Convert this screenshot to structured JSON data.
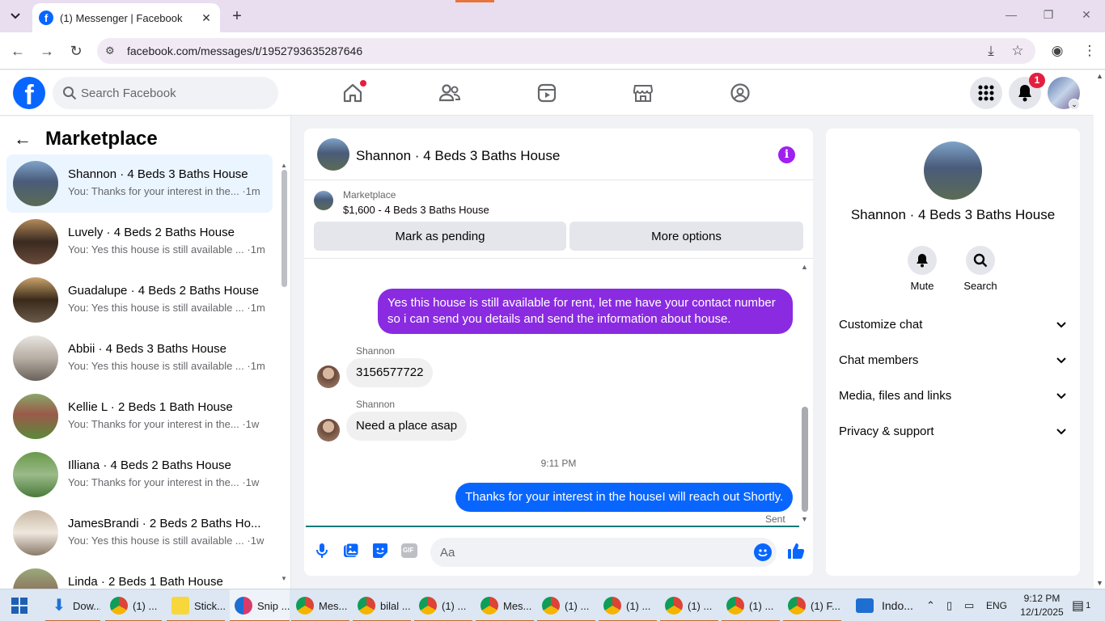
{
  "browser": {
    "tab_title": "(1) Messenger | Facebook",
    "url": "facebook.com/messages/t/1952793635287646"
  },
  "fb": {
    "search_placeholder": "Search Facebook",
    "notification_count": "1"
  },
  "left": {
    "title": "Marketplace",
    "conversations": [
      {
        "name": "Shannon · 4 Beds 3 Baths House",
        "snippet": "You: Thanks for your interest in the... ·1m"
      },
      {
        "name": "Luvely · 4 Beds 2 Baths House",
        "snippet": "You: Yes this house is still available ... ·1m"
      },
      {
        "name": "Guadalupe · 4 Beds 2 Baths House",
        "snippet": "You: Yes this house is still available ... ·1m"
      },
      {
        "name": "Abbii · 4 Beds 3 Baths House",
        "snippet": "You: Yes this house is still available ... ·1m"
      },
      {
        "name": "Kellie L · 2 Beds 1 Bath House",
        "snippet": "You: Thanks for your interest in the... ·1w"
      },
      {
        "name": "Illiana · 4 Beds 2 Baths House",
        "snippet": "You: Thanks for your interest in the... ·1w"
      },
      {
        "name": "JamesBrandi · 2 Beds 2 Baths Ho...",
        "snippet": "You: Yes this house is still available ... ·1w"
      },
      {
        "name": "Linda · 2 Beds 1 Bath House",
        "snippet": ""
      }
    ]
  },
  "chat": {
    "title": "Shannon · 4 Beds 3 Baths House",
    "marketplace_label": "Marketplace",
    "listing": "$1,600 - 4 Beds 3 Baths House",
    "mark_pending": "Mark as pending",
    "more_options": "More options",
    "msg_out_1": "Yes this house is still available for rent, let me have your contact number so i can send you details and send the information about house.",
    "sender_1": "Shannon",
    "msg_in_1": "3156577722",
    "sender_2": "Shannon",
    "msg_in_2": "Need a place asap",
    "timestamp": "9:11 PM",
    "msg_out_2": "Thanks for your interest in the houseI will reach out Shortly.",
    "sent_status": "Sent",
    "composer_placeholder": "Aa",
    "gif_label": "GIF"
  },
  "right": {
    "name": "Shannon · 4 Beds 3 Baths House",
    "mute": "Mute",
    "search": "Search",
    "rows": [
      "Customize chat",
      "Chat members",
      "Media, files and links",
      "Privacy & support"
    ]
  },
  "taskbar": {
    "items": [
      "Dow...",
      "(1) ...",
      "Stick...",
      "Snip ...",
      "Mes...",
      "bilal ...",
      "(1) ...",
      "Mes...",
      "(1) ...",
      "(1) ...",
      "(1) ...",
      "(1) ...",
      "(1) F..."
    ],
    "weather": "Indo...",
    "lang": "ENG",
    "time": "9:12 PM",
    "date": "12/1/2025",
    "notif": "1"
  },
  "colors": {
    "fb_blue": "#0866ff",
    "purple_bubble": "#8a2be2",
    "badge_red": "#e41e3f"
  }
}
